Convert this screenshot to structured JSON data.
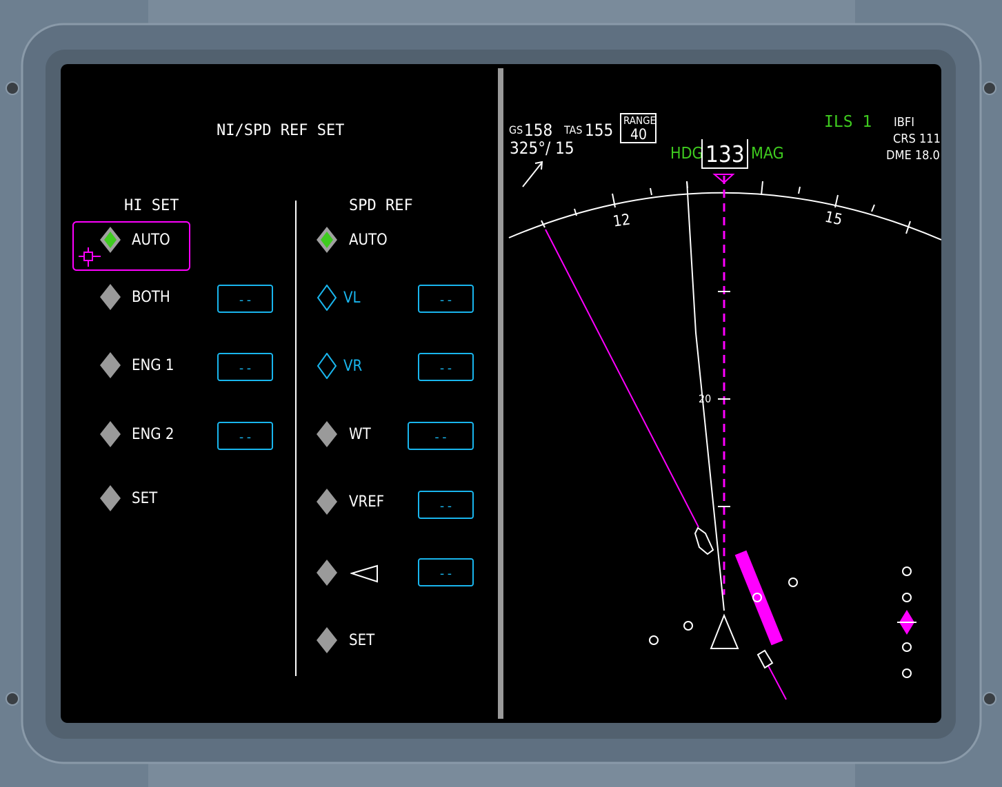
{
  "left_panel": {
    "title": "NI/SPD REF SET",
    "hi_set": {
      "heading": "HI SET",
      "items": [
        {
          "label": "AUTO",
          "state": "selected"
        },
        {
          "label": "BOTH",
          "value": "--"
        },
        {
          "label": "ENG 1",
          "value": "--"
        },
        {
          "label": "ENG 2",
          "value": "--"
        },
        {
          "label": "SET"
        }
      ]
    },
    "spd_ref": {
      "heading": "SPD REF",
      "items": [
        {
          "label": "AUTO",
          "state": "selected"
        },
        {
          "label": "VL",
          "value": "--",
          "state": "cyan"
        },
        {
          "label": "VR",
          "value": "--",
          "state": "cyan"
        },
        {
          "label": "WT",
          "value": "--"
        },
        {
          "label": "VREF",
          "value": "--"
        },
        {
          "label": "◁",
          "value": "--",
          "icon": "triangle-left-icon"
        },
        {
          "label": "SET"
        }
      ]
    }
  },
  "nav": {
    "gs_label": "GS",
    "gs_value": "158",
    "tas_label": "TAS",
    "tas_value": "155",
    "wind": "325°/ 15",
    "range_label": "RANGE",
    "range_value": "40",
    "hdg_label": "HDG",
    "hdg_value": "133",
    "mag_label": "MAG",
    "source": "ILS 1",
    "ident": "IBFI",
    "crs": "CRS 111",
    "dme": "DME 18.0",
    "compass_labels": [
      "12",
      "15"
    ],
    "range_mark": "20"
  },
  "colors": {
    "cyan": "#19b6ee",
    "magenta": "#ff00ff",
    "green": "#3fcc1f",
    "selected_diamond": "#3fcc1f",
    "diamond": "#9a9a9a"
  }
}
